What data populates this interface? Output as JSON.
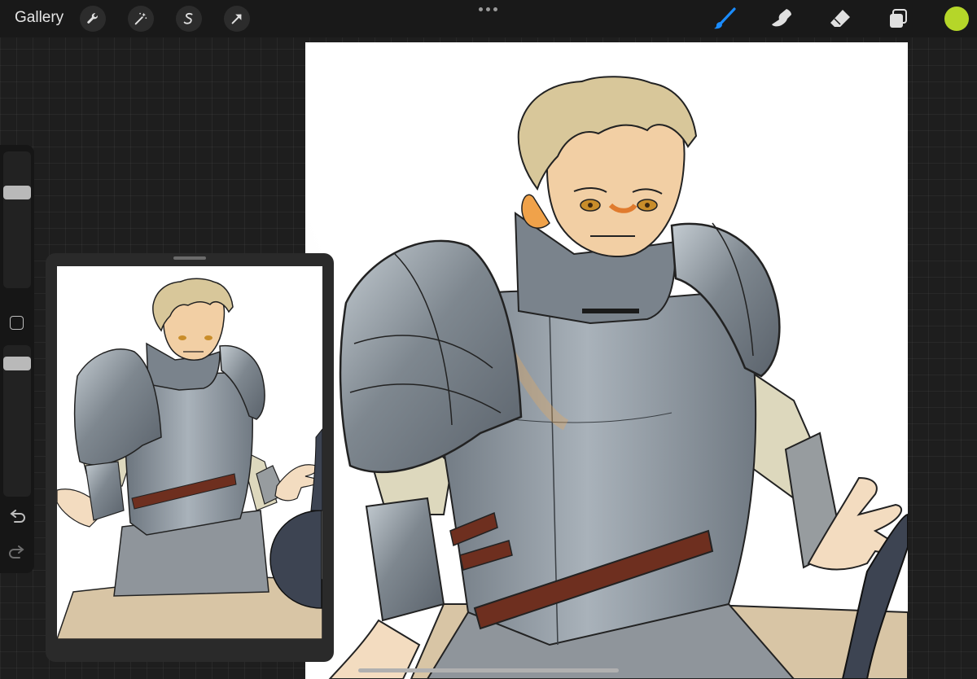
{
  "toolbar": {
    "gallery_label": "Gallery",
    "actions": [
      {
        "icon": "wrench-icon"
      },
      {
        "icon": "magic-wand-icon"
      },
      {
        "icon": "selection-s-icon"
      },
      {
        "icon": "transform-arrow-icon"
      }
    ],
    "more_icon": "ellipsis-icon",
    "tools": [
      {
        "icon": "brush-icon",
        "active": true
      },
      {
        "icon": "smudge-icon",
        "active": false
      },
      {
        "icon": "eraser-icon",
        "active": false
      },
      {
        "icon": "layers-icon",
        "active": false
      }
    ],
    "current_color": "#b5d629",
    "active_tool_color": "#1a8cff"
  },
  "sidebar": {
    "brush_size_level": 0.72,
    "opacity_level": 0.92,
    "icons": [
      "modify-square-icon",
      "undo-icon",
      "redo-icon"
    ]
  },
  "reference_window": {
    "content": "reference-artwork-thumbnail"
  },
  "canvas": {
    "content": "knight-artwork"
  }
}
